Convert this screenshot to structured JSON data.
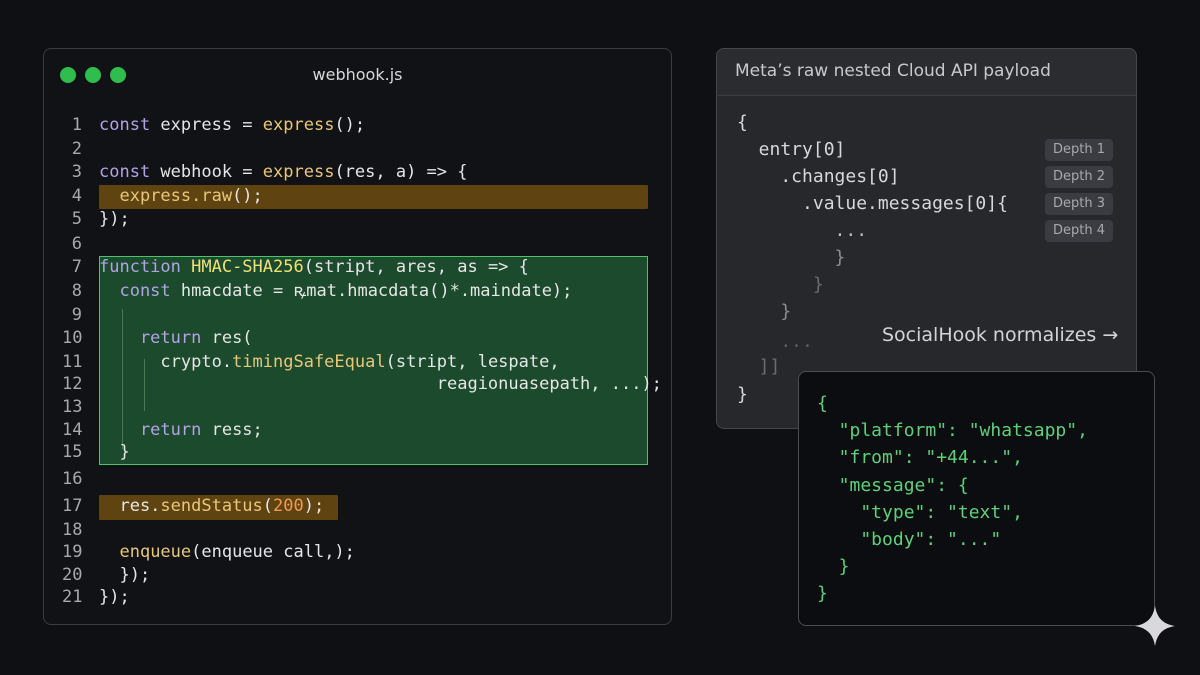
{
  "editor": {
    "filename": "webhook.js",
    "lines": [
      {
        "n": "1",
        "tokens": [
          [
            "kw",
            "const "
          ],
          [
            "pl",
            "express = "
          ],
          [
            "fn",
            "express"
          ],
          [
            "pl",
            "();"
          ]
        ]
      },
      {
        "n": "2",
        "tokens": []
      },
      {
        "n": "3",
        "tokens": [
          [
            "kw",
            "const "
          ],
          [
            "pl",
            "webhook = "
          ],
          [
            "fn",
            "express"
          ],
          [
            "pl",
            "(res, a) => {"
          ]
        ]
      },
      {
        "n": "4",
        "tokens": [
          [
            "fn",
            "  express.raw"
          ],
          [
            "pl",
            "();"
          ]
        ]
      },
      {
        "n": "5",
        "tokens": [
          [
            "pl",
            "});"
          ]
        ]
      },
      {
        "n": "6",
        "tokens": []
      },
      {
        "n": "7",
        "tokens": [
          [
            "kw",
            "function "
          ],
          [
            "hdr",
            "HMAC-SHA256"
          ],
          [
            "pl",
            "(stript, ares, as => {"
          ]
        ]
      },
      {
        "n": "8",
        "tokens": [
          [
            "kw",
            "  const "
          ],
          [
            "pl",
            "hmacdate = ꝶmat.hmacdata()*.maindate);"
          ]
        ]
      },
      {
        "n": "9",
        "tokens": []
      },
      {
        "n": "10",
        "tokens": [
          [
            "kw",
            "    return "
          ],
          [
            "pl",
            "res("
          ]
        ]
      },
      {
        "n": "11",
        "tokens": [
          [
            "pl",
            "      crypto."
          ],
          [
            "fn",
            "timingSafeEqual"
          ],
          [
            "pl",
            "(stript, lespate,"
          ]
        ]
      },
      {
        "n": "12",
        "tokens": [
          [
            "pl",
            "                                 reagionuasepath, ...);"
          ]
        ]
      },
      {
        "n": "13",
        "tokens": []
      },
      {
        "n": "14",
        "tokens": [
          [
            "kw",
            "    return "
          ],
          [
            "pl",
            "ress;"
          ]
        ]
      },
      {
        "n": "15",
        "tokens": [
          [
            "pl",
            "  }"
          ]
        ]
      },
      {
        "n": "16",
        "tokens": []
      },
      {
        "n": "17",
        "tokens": [
          [
            "pl",
            "  res."
          ],
          [
            "fn",
            "sendStatus"
          ],
          [
            "pl",
            "("
          ],
          [
            "num",
            "200"
          ],
          [
            "pl",
            ");"
          ]
        ]
      },
      {
        "n": "18",
        "tokens": []
      },
      {
        "n": "19",
        "tokens": [
          [
            "pl",
            "  "
          ],
          [
            "fn",
            "enqueue"
          ],
          [
            "pl",
            "(enqueue call,);"
          ]
        ]
      },
      {
        "n": "20",
        "tokens": [
          [
            "pl",
            "  });"
          ]
        ]
      },
      {
        "n": "21",
        "tokens": [
          [
            "pl",
            "});"
          ]
        ]
      }
    ]
  },
  "payload": {
    "title": "Meta’s raw nested Cloud API payload",
    "lines": [
      {
        "text": "{",
        "color": "#d8d8da"
      },
      {
        "text": "  entry[0]",
        "color": "#d8d8da"
      },
      {
        "text": "    .changes[0]",
        "color": "#d8d8da"
      },
      {
        "text": "      .value.messages[0]{",
        "color": "#d8d8da"
      },
      {
        "text": "         ...",
        "color": "#bdbdc0"
      },
      {
        "text": "         }",
        "color": "#8d8e92"
      },
      {
        "text": "       }",
        "color": "#6b6c70"
      },
      {
        "text": "    }",
        "color": "#8d8e92"
      },
      {
        "text": "    ...",
        "color": "#5d5e62"
      },
      {
        "text": "  ]]",
        "color": "#6b6c70"
      },
      {
        "text": "}",
        "color": "#d8d8da"
      }
    ],
    "depths": [
      "Depth 1",
      "Depth 2",
      "Depth 3",
      "Depth 4"
    ]
  },
  "normalize_label": "SocialHook normalizes →",
  "result": {
    "lines": [
      "{",
      "  \"platform\": \"whatsapp\",",
      "  \"from\": \"+44...\",",
      "  \"message\": {",
      "    \"type\": \"text\",",
      "    \"body\": \"...\"",
      "  }",
      "}"
    ]
  },
  "colors": {
    "accent_green": "#4cc36a",
    "highlight_yellow": "#5f4310",
    "window_dot": "#2fbd4e"
  },
  "icons": [
    "window-dot-icon",
    "sparkle-icon"
  ]
}
